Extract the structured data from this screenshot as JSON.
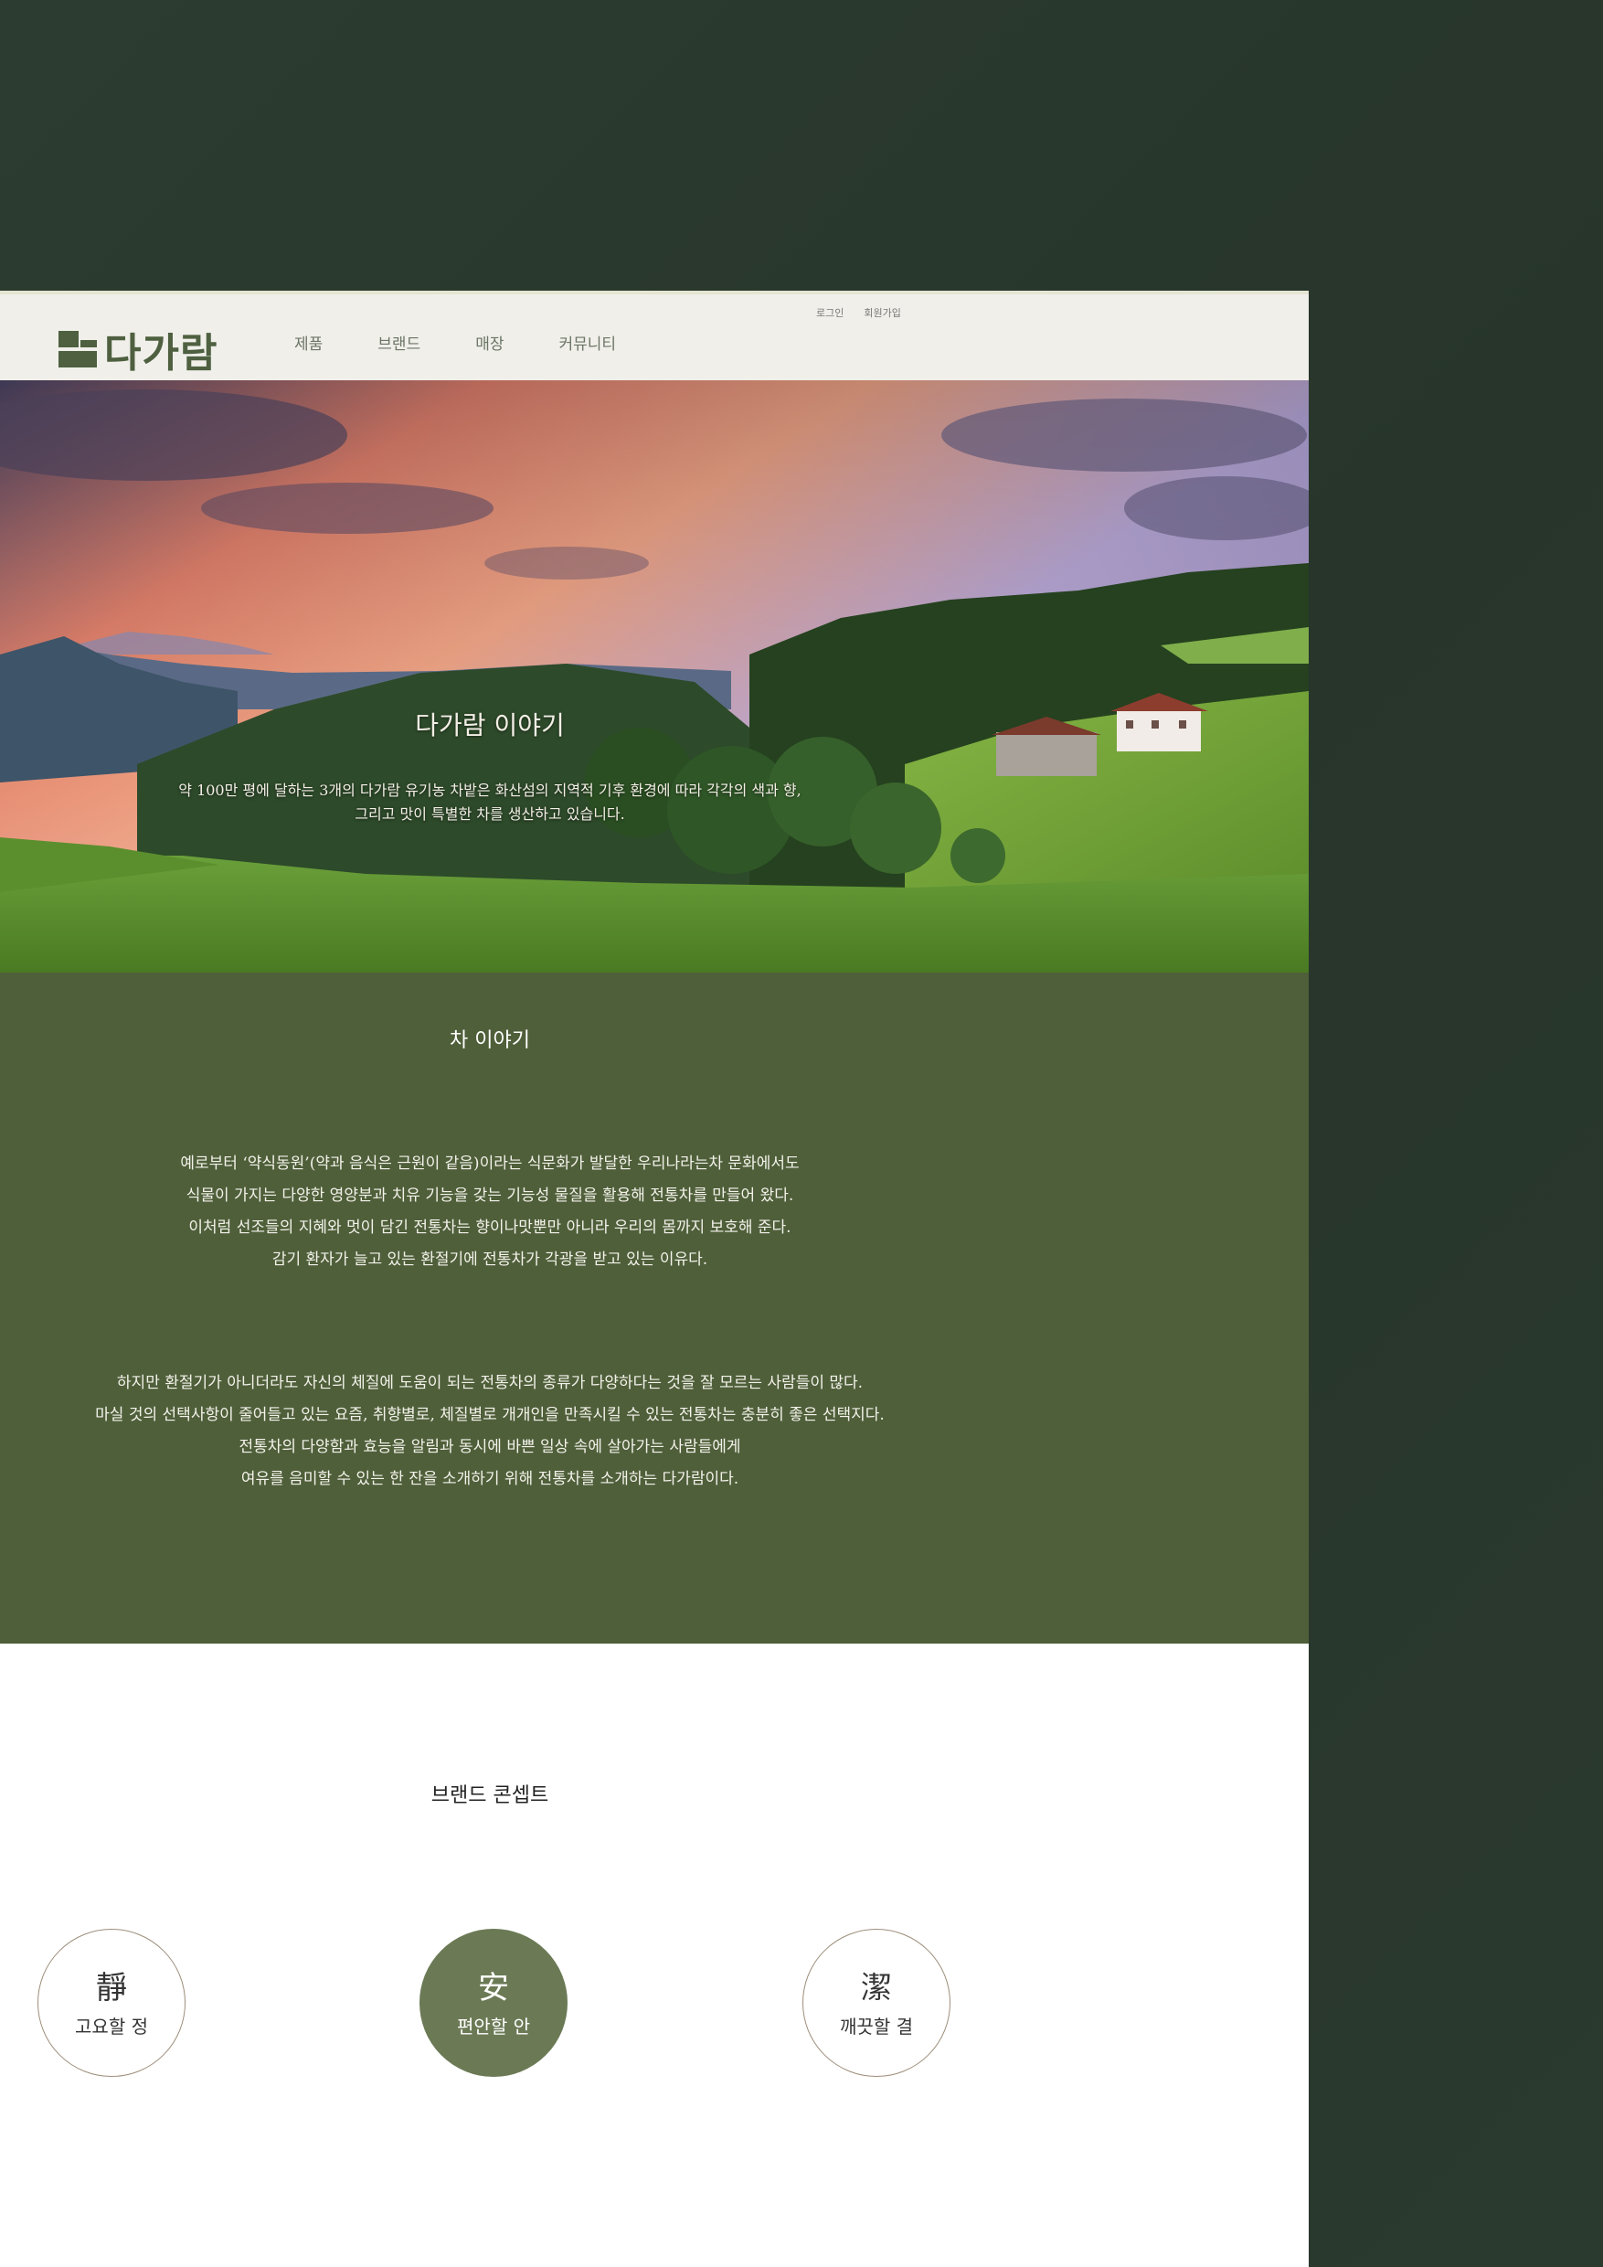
{
  "header": {
    "logo_text": "다가람",
    "nav": [
      "제품",
      "브랜드",
      "매장",
      "커뮤니티"
    ],
    "util": [
      "로그인",
      "회원가입"
    ]
  },
  "hero": {
    "title": "다가람 이야기",
    "desc_line1": "약 100만 평에 달하는 3개의 다가람 유기농 차밭은 화산섬의 지역적 기후 환경에 따라 각각의 색과 향,",
    "desc_line2": "그리고 맛이 특별한 차를 생산하고 있습니다."
  },
  "story": {
    "title": "차 이야기",
    "para1": [
      "예로부터 ‘약식동원’(약과 음식은 근원이 같음)이라는 식문화가 발달한 우리나라는차 문화에서도",
      "식물이 가지는 다양한 영양분과 치유 기능을 갖는 기능성 물질을 활용해 전통차를 만들어 왔다.",
      "이처럼 선조들의 지혜와 멋이 담긴 전통차는 향이나맛뿐만 아니라 우리의 몸까지 보호해 준다.",
      "감기 환자가 늘고 있는 환절기에 전통차가 각광을 받고 있는 이유다."
    ],
    "para2": [
      "하지만 환절기가 아니더라도 자신의 체질에 도움이 되는 전통차의 종류가 다양하다는 것을 잘 모르는 사람들이 많다.",
      "마실 것의 선택사항이 줄어들고 있는 요즘, 취향별로, 체질별로 개개인을 만족시킬 수 있는 전통차는 충분히 좋은 선택지다.",
      "전통차의 다양함과 효능을 알림과 동시에 바쁜 일상 속에 살아가는 사람들에게",
      "여유를 음미할 수 있는 한 잔을 소개하기 위해 전통차를 소개하는 다가람이다."
    ]
  },
  "brand": {
    "title": "브랜드 콘셉트",
    "concepts": [
      {
        "hanja": "靜",
        "label": "고요할 정"
      },
      {
        "hanja": "安",
        "label": "편안할 안"
      },
      {
        "hanja": "潔",
        "label": "깨끗할 결"
      }
    ]
  },
  "colors": {
    "brand_green": "#4e6040",
    "story_bg": "#4f5f3a",
    "active_circle": "#6b7a55",
    "page_bg": "#2a3a2e"
  }
}
